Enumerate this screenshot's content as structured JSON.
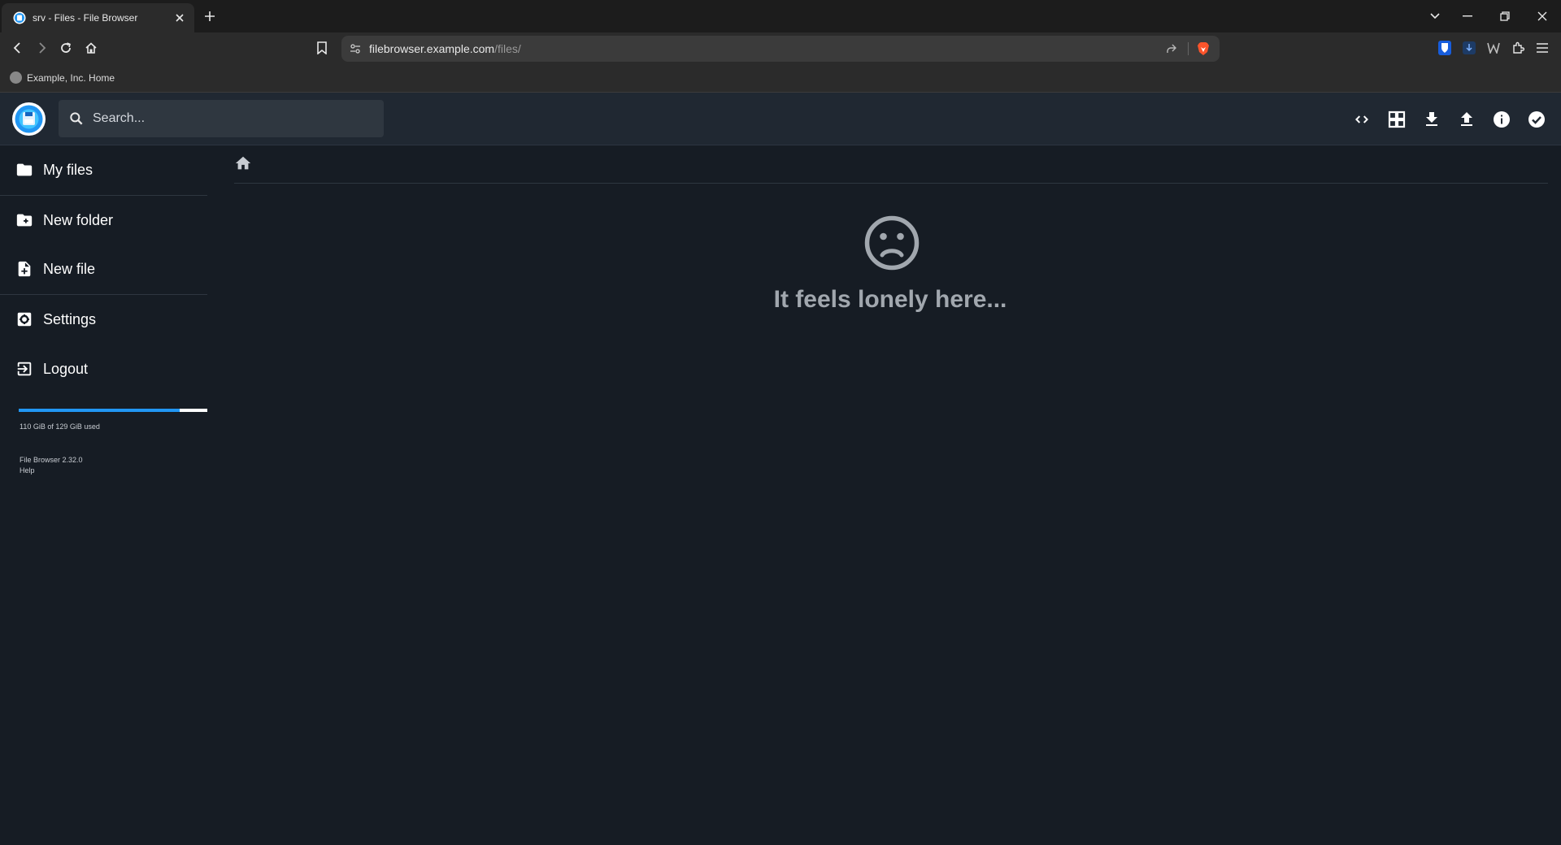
{
  "browser": {
    "tab_title": "srv - Files - File Browser",
    "url_host": "filebrowser.example.com",
    "url_path": "/files/",
    "bookmark_label": "Example, Inc. Home"
  },
  "app": {
    "search_placeholder": "Search...",
    "accent_color": "#2196f3"
  },
  "sidebar": {
    "items": [
      {
        "label": "My files",
        "icon": "folder-icon"
      },
      {
        "label": "New folder",
        "icon": "create-new-folder-icon"
      },
      {
        "label": "New file",
        "icon": "note-add-icon"
      },
      {
        "label": "Settings",
        "icon": "settings-applications-icon"
      },
      {
        "label": "Logout",
        "icon": "exit-to-app-icon"
      }
    ],
    "usage_text": "110 GiB of 129 GiB used",
    "usage_fraction": 0.853,
    "version": "File Browser 2.32.0",
    "help": "Help"
  },
  "main": {
    "empty_message": "It feels lonely here...",
    "empty_icon": "sentiment-dissatisfied-icon"
  },
  "header_actions": [
    "code-icon",
    "grid-view-icon",
    "download-icon",
    "upload-icon",
    "info-icon",
    "check-circle-icon"
  ]
}
